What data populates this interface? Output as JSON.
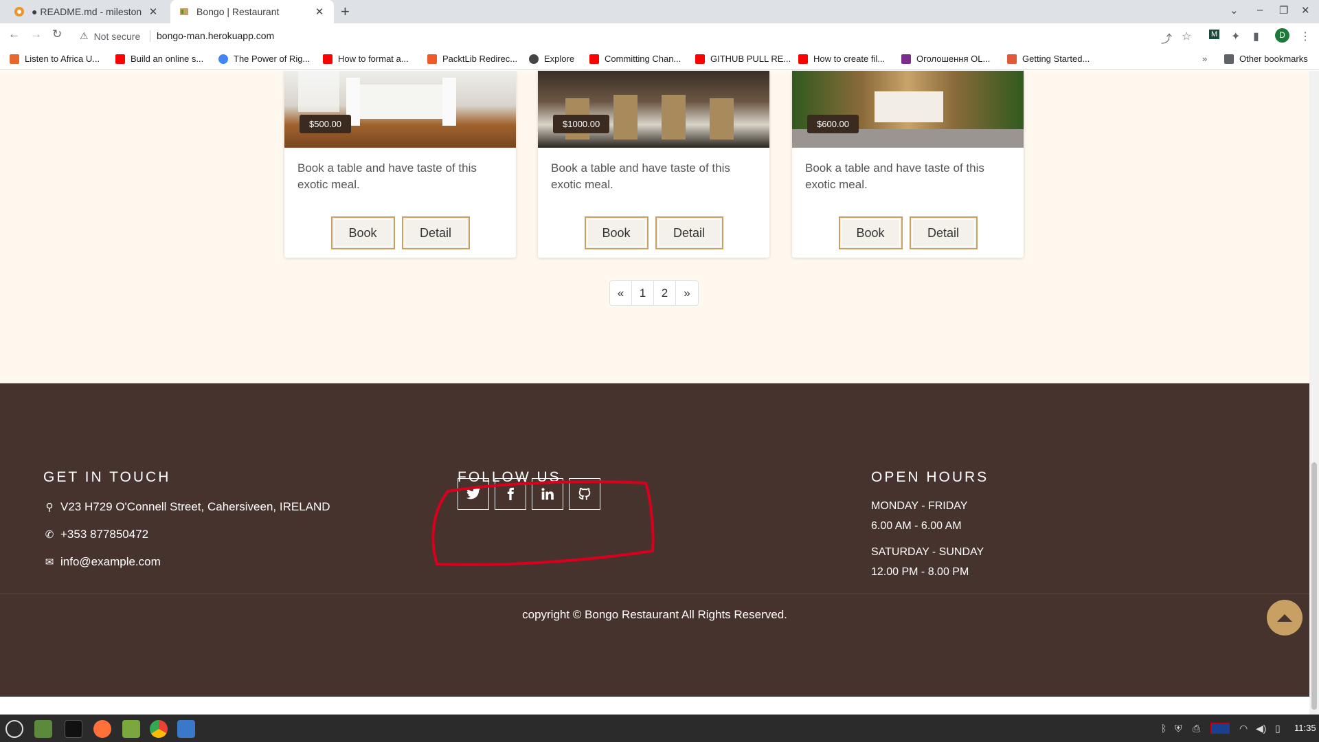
{
  "browser": {
    "tabs": [
      {
        "title": "● README.md - milestone_pr",
        "active": false
      },
      {
        "title": "Bongo | Restaurant",
        "active": true
      }
    ],
    "security_label": "Not secure",
    "url": "bongo-man.herokuapp.com",
    "avatar_letter": "D",
    "bookmarks": [
      {
        "label": "Listen to Africa U...",
        "icon": "africa-icon",
        "color": "#e8672f"
      },
      {
        "label": "Build an online s...",
        "icon": "youtube-icon",
        "color": "#ff0000"
      },
      {
        "label": "The Power of Rig...",
        "icon": "google-icon",
        "color": "#4285f4"
      },
      {
        "label": "How to format a...",
        "icon": "youtube-icon",
        "color": "#ff0000"
      },
      {
        "label": "PacktLib Redirec...",
        "icon": "packt-icon",
        "color": "#f05a28"
      },
      {
        "label": "Explore",
        "icon": "explore-icon",
        "color": "#444444"
      },
      {
        "label": "Committing Chan...",
        "icon": "youtube-icon",
        "color": "#ff0000"
      },
      {
        "label": "GITHUB PULL RE...",
        "icon": "youtube-icon",
        "color": "#ff0000"
      },
      {
        "label": "How to create fil...",
        "icon": "youtube-icon",
        "color": "#ff0000"
      },
      {
        "label": "Оголошення OL...",
        "icon": "olx-icon",
        "color": "#7b2d8e"
      },
      {
        "label": "Getting Started...",
        "icon": "getting-started-icon",
        "color": "#e05a3a"
      }
    ],
    "other_bookmarks": "Other bookmarks",
    "more_chevron": "»"
  },
  "cards": [
    {
      "price": "$500.00",
      "description": "Book a table and have taste of this exotic meal.",
      "book": "Book",
      "detail": "Detail"
    },
    {
      "price": "$1000.00",
      "description": "Book a table and have taste of this exotic meal.",
      "book": "Book",
      "detail": "Detail"
    },
    {
      "price": "$600.00",
      "description": "Book a table and have taste of this exotic meal.",
      "book": "Book",
      "detail": "Detail"
    }
  ],
  "pagination": {
    "prev": "«",
    "pages": [
      "1",
      "2"
    ],
    "next": "»"
  },
  "footer": {
    "contact": {
      "heading": "GET IN TOUCH",
      "address": "V23 H729 O'Connell Street, Cahersiveen, IRELAND",
      "phone": "+353 877850472",
      "email": "info@example.com"
    },
    "follow": {
      "heading": "FOLLOW US",
      "icons": [
        "twitter-icon",
        "facebook-icon",
        "linkedin-icon",
        "github-icon"
      ]
    },
    "hours": {
      "heading": "OPEN HOURS",
      "weekday_label": "MONDAY - FRIDAY",
      "weekday_time": "6.00 AM - 6.00 AM",
      "weekend_label": "SATURDAY - SUNDAY",
      "weekend_time": "12.00 PM - 8.00 PM"
    },
    "copyright": "copyright © Bongo Restaurant All Rights Reserved."
  },
  "taskbar": {
    "clock": "11:35"
  },
  "colors": {
    "footer_bg": "#47332e",
    "page_bg": "#fff8ef",
    "accent_gold": "#c9a064",
    "annotation_red": "#d9001b"
  }
}
